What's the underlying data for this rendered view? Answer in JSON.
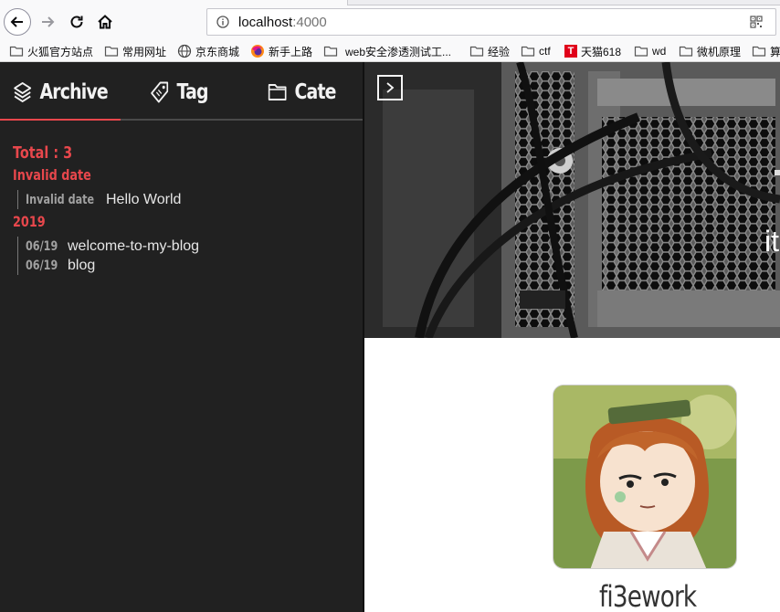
{
  "browser": {
    "url_host": "localhost",
    "url_port": ":4000",
    "bookmarks": [
      {
        "label": "火狐官方站点",
        "icon": "folder-icon"
      },
      {
        "label": "常用网址",
        "icon": "folder-icon"
      },
      {
        "label": "京东商城",
        "icon": "globe-icon"
      },
      {
        "label": "新手上路",
        "icon": "firefox-icon"
      },
      {
        "label": "web安全渗透测试工...",
        "icon": "folder-icon"
      },
      {
        "label": "经验",
        "icon": "folder-icon"
      },
      {
        "label": "ctf",
        "icon": "folder-icon"
      },
      {
        "label": "天猫618",
        "icon": "tmall-icon",
        "badge": "T"
      },
      {
        "label": "wd",
        "icon": "folder-icon"
      },
      {
        "label": "微机原理",
        "icon": "folder-icon"
      },
      {
        "label": "算",
        "icon": "folder-icon"
      }
    ]
  },
  "sidebar": {
    "tabs": [
      {
        "label": "Archive",
        "icon": "layers-icon",
        "active": true
      },
      {
        "label": "Tag",
        "icon": "tag-icon",
        "active": false
      },
      {
        "label": "Cate",
        "icon": "folder-icon",
        "active": false
      }
    ],
    "total": "Total : 3",
    "groups": [
      {
        "year": "Invalid date",
        "posts": [
          {
            "date": "Invalid date",
            "title": "Hello World"
          }
        ]
      },
      {
        "year": "2019",
        "posts": [
          {
            "date": "06/19",
            "title": "welcome-to-my-blog"
          },
          {
            "date": "06/19",
            "title": "blog"
          }
        ]
      }
    ]
  },
  "hero": {
    "partial_text": "it"
  },
  "profile": {
    "author": "fi3ework"
  },
  "colors": {
    "accent": "#e8474c",
    "sidebar_bg": "#212121"
  }
}
